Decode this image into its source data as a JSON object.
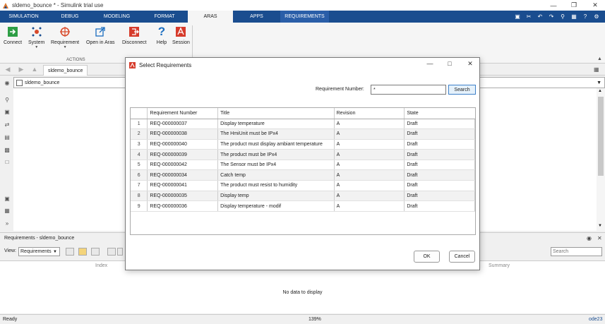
{
  "window": {
    "title": "sldemo_bounce * - Simulink trial use"
  },
  "tabs": [
    {
      "label": "SIMULATION",
      "width": 67
    },
    {
      "label": "DEBUG",
      "width": 64
    },
    {
      "label": "MODELING",
      "width": 69
    },
    {
      "label": "FORMAT",
      "width": 66
    },
    {
      "label": "ARAS",
      "width": 64
    },
    {
      "label": "APPS",
      "width": 67
    },
    {
      "label": "REQUIREMENTS",
      "width": 69
    }
  ],
  "ribbon": {
    "buttons": [
      {
        "label": "Connect",
        "icon": "connect-icon",
        "caret": false
      },
      {
        "label": "System",
        "icon": "system-icon",
        "caret": true
      },
      {
        "label": "Requirement",
        "icon": "requirement-icon",
        "caret": true
      },
      {
        "label": "Open in Aras",
        "icon": "open-external-icon",
        "caret": false
      },
      {
        "label": "Disconnect",
        "icon": "disconnect-icon",
        "caret": false
      },
      {
        "label": "Help",
        "icon": "help-icon",
        "caret": false
      },
      {
        "label": "Session",
        "icon": "session-icon",
        "caret": false
      }
    ],
    "group_label": "ACTIONS"
  },
  "model_tab": "sldemo_bounce",
  "breadcrumb": "sldemo_bounce",
  "req_panel": {
    "title": "Requirements - sldemo_bounce",
    "view_label": "View:",
    "view_value": "Requirements",
    "search_placeholder": "Search",
    "col_index": "Index",
    "col_summary": "Summary",
    "empty_text": "No data to display"
  },
  "status": {
    "ready": "Ready",
    "zoom": "139%",
    "solver": "ode23"
  },
  "dialog": {
    "title": "Select Requirements",
    "req_number_label": "Requirement Number:",
    "req_number_value": "*",
    "search_button": "Search",
    "columns": [
      "Requirement Number",
      "Title",
      "Revision",
      "State"
    ],
    "rows": [
      {
        "n": "1",
        "number": "REQ-000000037",
        "title": "Display temperature",
        "revision": "A",
        "state": "Draft"
      },
      {
        "n": "2",
        "number": "REQ-000000038",
        "title": "The HmiUnit must be IPx4",
        "revision": "A",
        "state": "Draft"
      },
      {
        "n": "3",
        "number": "REQ-000000040",
        "title": "The product must display ambiant temperature",
        "revision": "A",
        "state": "Draft"
      },
      {
        "n": "4",
        "number": "REQ-000000039",
        "title": "The product must be IPx4",
        "revision": "A",
        "state": "Draft"
      },
      {
        "n": "5",
        "number": "REQ-000000042",
        "title": "The Sensor must be IPx4",
        "revision": "A",
        "state": "Draft"
      },
      {
        "n": "6",
        "number": "REQ-000000034",
        "title": "Catch temp",
        "revision": "A",
        "state": "Draft"
      },
      {
        "n": "7",
        "number": "REQ-000000041",
        "title": "The product must resist to humidity",
        "revision": "A",
        "state": "Draft"
      },
      {
        "n": "8",
        "number": "REQ-000000035",
        "title": "Display temp",
        "revision": "A",
        "state": "Draft"
      },
      {
        "n": "9",
        "number": "REQ-000000036",
        "title": "Display temperature - modif",
        "revision": "A",
        "state": "Draft"
      }
    ],
    "ok_button": "OK",
    "cancel_button": "Cancel"
  }
}
